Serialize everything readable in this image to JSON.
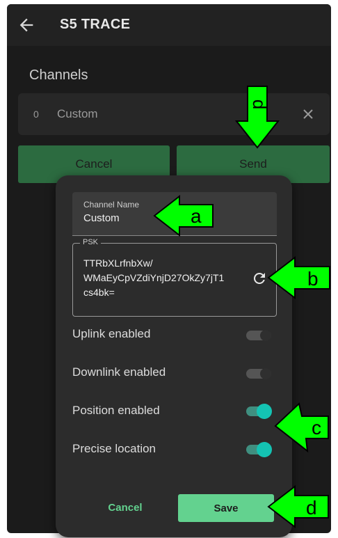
{
  "app": {
    "title": "S5 TRACE",
    "back_icon": "arrow-left-icon"
  },
  "channels": {
    "section_title": "Channels",
    "items": [
      {
        "index": "0",
        "name": "Custom"
      }
    ]
  },
  "actions": {
    "cancel_label": "Cancel",
    "send_label": "Send"
  },
  "dialog": {
    "name_field": {
      "label": "Channel Name",
      "value": "Custom"
    },
    "psk_field": {
      "label": "PSK",
      "value": "TTRbXLrfnbXw/\nWMaEyCpVZdiYnjD27OkZy7jT1\ncs4bk="
    },
    "toggles": [
      {
        "label": "Uplink enabled",
        "on": false
      },
      {
        "label": "Downlink enabled",
        "on": false
      },
      {
        "label": "Position enabled",
        "on": true
      },
      {
        "label": "Precise location",
        "on": true
      }
    ],
    "cancel_label": "Cancel",
    "save_label": "Save"
  },
  "callouts": {
    "a": "a",
    "b": "b",
    "c": "c",
    "d_top": "d",
    "d_bottom": "d"
  },
  "colors": {
    "background": "#1b1b1b",
    "dialog": "#2c2c2c",
    "primary_green": "#63d28f",
    "dark_green": "#2c6b40",
    "switch_on": "#14c3b3",
    "callout": "#00ff00"
  }
}
